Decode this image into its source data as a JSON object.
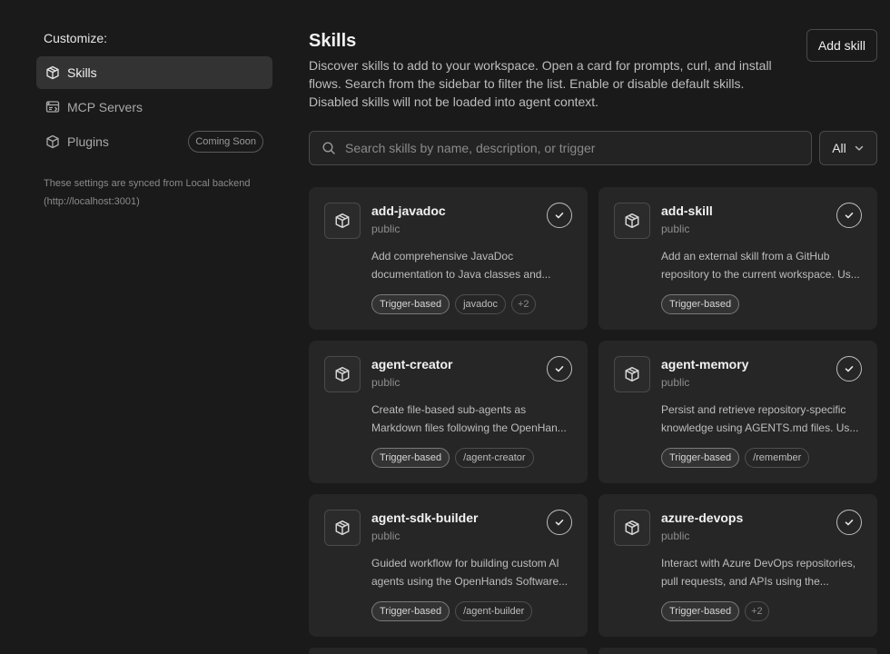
{
  "sidebar": {
    "title": "Customize:",
    "items": [
      {
        "label": "Skills",
        "icon": "cube-icon",
        "active": true
      },
      {
        "label": "MCP Servers",
        "icon": "server-icon",
        "active": false
      },
      {
        "label": "Plugins",
        "icon": "package-icon",
        "active": false,
        "badge": "Coming Soon"
      }
    ],
    "sync_note_line1": "These settings are synced from Local backend",
    "sync_note_line2": "(http://localhost:3001)"
  },
  "main": {
    "title": "Skills",
    "description": "Discover skills to add to your workspace. Open a card for prompts, curl, and install flows. Search from the sidebar to filter the list. Enable or disable default skills. Disabled skills will not be loaded into agent context.",
    "add_button": "Add skill",
    "search_placeholder": "Search skills by name, description, or trigger",
    "filter_value": "All"
  },
  "skills": [
    {
      "name": "add-javadoc",
      "visibility": "public",
      "desc1": "Add comprehensive JavaDoc",
      "desc2": "documentation to Java classes and...",
      "tags": [
        "Trigger-based",
        "javadoc"
      ],
      "more": "+2",
      "enabled": true
    },
    {
      "name": "add-skill",
      "visibility": "public",
      "desc1": "Add an external skill from a GitHub",
      "desc2": "repository to the current workspace. Us...",
      "tags": [
        "Trigger-based"
      ],
      "more": "",
      "enabled": true
    },
    {
      "name": "agent-creator",
      "visibility": "public",
      "desc1": "Create file-based sub-agents as",
      "desc2": "Markdown files following the OpenHan...",
      "tags": [
        "Trigger-based",
        "/agent-creator"
      ],
      "more": "",
      "enabled": true
    },
    {
      "name": "agent-memory",
      "visibility": "public",
      "desc1": "Persist and retrieve repository-specific",
      "desc2": "knowledge using AGENTS.md files. Us...",
      "tags": [
        "Trigger-based",
        "/remember"
      ],
      "more": "",
      "enabled": true
    },
    {
      "name": "agent-sdk-builder",
      "visibility": "public",
      "desc1": "Guided workflow for building custom AI",
      "desc2": "agents using the OpenHands Software...",
      "tags": [
        "Trigger-based",
        "/agent-builder"
      ],
      "more": "",
      "enabled": true
    },
    {
      "name": "azure-devops",
      "visibility": "public",
      "desc1": "Interact with Azure DevOps repositories,",
      "desc2": "pull requests, and APIs using the...",
      "tags": [
        "Trigger-based"
      ],
      "more": "+2",
      "enabled": true
    }
  ]
}
